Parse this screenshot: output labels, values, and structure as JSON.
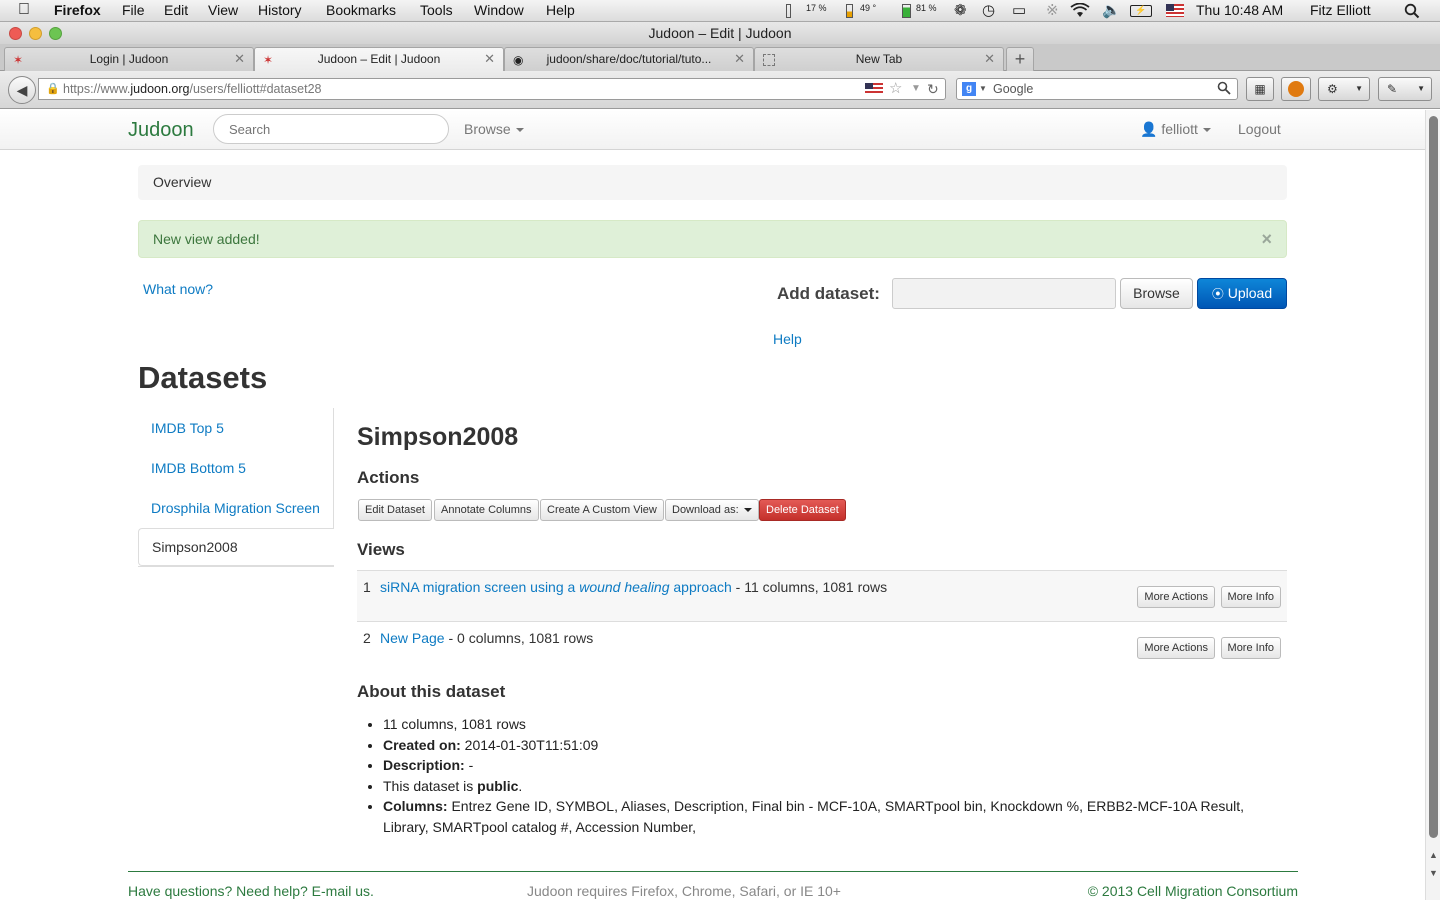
{
  "menubar": {
    "app": "Firefox",
    "items": [
      "File",
      "Edit",
      "View",
      "History",
      "Bookmarks",
      "Tools",
      "Window",
      "Help"
    ],
    "status": {
      "cpu": "17 %",
      "temp": "49 °",
      "ram": "81 %"
    },
    "clock": "Thu 10:48 AM",
    "user": "Fitz Elliott"
  },
  "window": {
    "title": "Judoon – Edit | Judoon"
  },
  "tabs": [
    {
      "label": "Login | Judoon"
    },
    {
      "label": "Judoon – Edit | Judoon"
    },
    {
      "label": "judoon/share/doc/tutorial/tuto..."
    },
    {
      "label": "New Tab"
    }
  ],
  "navbar": {
    "url_prefix": "https://www.",
    "url_domain": "judoon.org",
    "url_path": "/users/felliott#dataset28",
    "search_engine": "Google"
  },
  "site": {
    "brand": "Judoon",
    "search_placeholder": "Search",
    "browse": "Browse",
    "user": "felliott",
    "logout": "Logout"
  },
  "breadcrumb": "Overview",
  "alert": {
    "text": "New view added!",
    "close": "×"
  },
  "what_now": "What now?",
  "add_dataset": {
    "label": "Add dataset:",
    "browse": "Browse",
    "upload": "Upload",
    "help": "Help"
  },
  "datasets_heading": "Datasets",
  "datasets": [
    "IMDB Top 5",
    "IMDB Bottom 5",
    "Drosphila Migration Screen",
    "Simpson2008"
  ],
  "dataset": {
    "title": "Simpson2008",
    "actions_heading": "Actions",
    "actions": {
      "edit": "Edit Dataset",
      "annotate": "Annotate Columns",
      "custom": "Create A Custom View",
      "download": "Download as:",
      "delete": "Delete Dataset"
    },
    "views_heading": "Views",
    "views": [
      {
        "num": "1",
        "link_a": "siRNA migration screen using a ",
        "link_em": "wound healing",
        "link_b": " approach",
        "meta": " - 11 columns, 1081 rows"
      },
      {
        "num": "2",
        "link_a": "New Page",
        "link_em": "",
        "link_b": "",
        "meta": " - 0 columns, 1081 rows"
      }
    ],
    "view_buttons": {
      "more_actions": "More Actions",
      "more_info": "More Info"
    },
    "about_heading": "About this dataset",
    "about": {
      "size": "11 columns, 1081 rows",
      "created_label": "Created on:",
      "created": " 2014-01-30T11:51:09",
      "desc_label": "Description:",
      "desc": " -",
      "public_a": "This dataset is ",
      "public_b": "public",
      "public_c": ".",
      "columns_label": "Columns:",
      "columns": " Entrez Gene ID, SYMBOL, Aliases, Description, Final bin - MCF-10A, SMARTpool bin, Knockdown %, ERBB2-MCF-10A Result, Library, SMARTpool catalog #, Accession Number,"
    }
  },
  "footer": {
    "left": "Have questions? Need help? E-mail us.",
    "center": "Judoon requires Firefox, Chrome, Safari, or IE 10+",
    "right": "© 2013 Cell Migration Consortium"
  },
  "colors": {
    "brand": "#2c7a3f",
    "link": "#0e7bc3",
    "upload": "#0e86d8",
    "delete": "#c4302b",
    "alert_bg": "#dff0d8"
  }
}
